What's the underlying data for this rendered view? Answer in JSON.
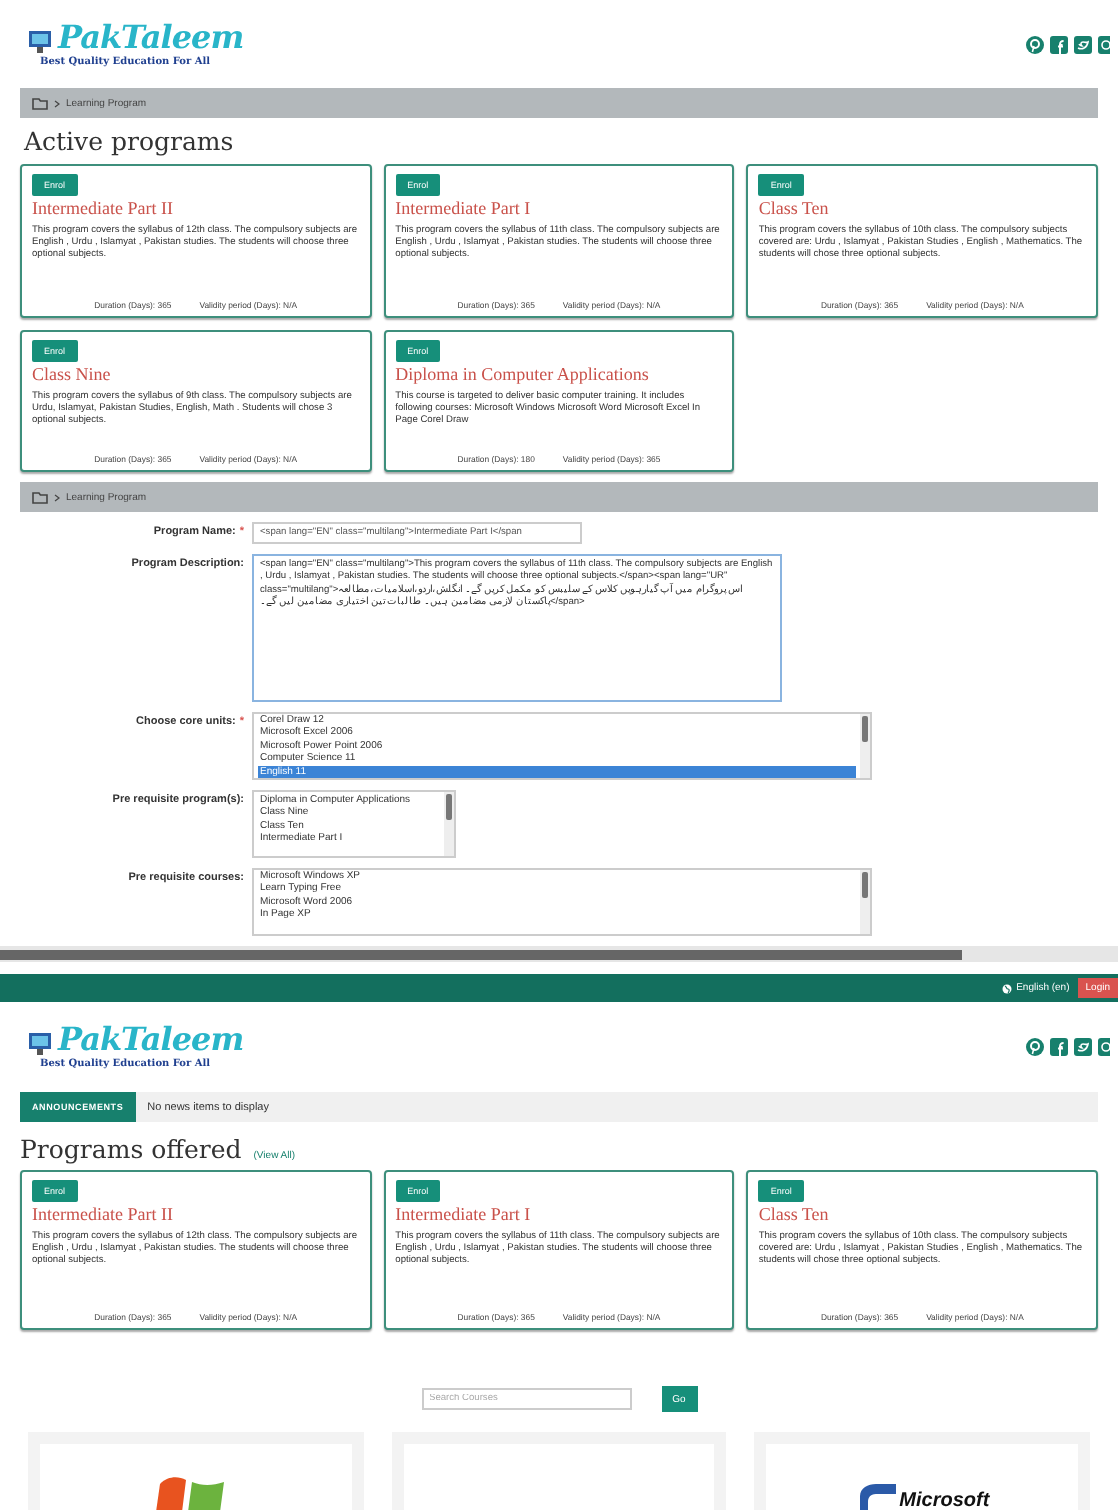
{
  "screen1": {
    "logo": {
      "name": "PakTaleem",
      "tagline": "Best Quality Education For All"
    },
    "breadcrumb": "Learning Program",
    "heading": "Active programs",
    "programs": [
      {
        "enrol": "Enrol",
        "title": "Intermediate Part II",
        "description": "This program covers the syllabus of 12th class. The compulsory subjects are English , Urdu , Islamyat , Pakistan studies. The students will choose three optional subjects.",
        "duration": "Duration (Days): 365",
        "validity": "Validity period (Days): N/A"
      },
      {
        "enrol": "Enrol",
        "title": "Intermediate Part I",
        "description": "This program covers the syllabus of 11th class. The compulsory subjects are English , Urdu , Islamyat , Pakistan studies. The students will choose three optional subjects.",
        "duration": "Duration (Days): 365",
        "validity": "Validity period (Days): N/A"
      },
      {
        "enrol": "Enrol",
        "title": "Class Ten",
        "description": "This program covers the syllabus of 10th class. The compulsory subjects covered are: Urdu , Islamyat , Pakistan Studies , English , Mathematics. The students will chose three optional subjects.",
        "duration": "Duration (Days): 365",
        "validity": "Validity period (Days): N/A"
      },
      {
        "enrol": "Enrol",
        "title": "Class Nine",
        "description": "This program covers the syllabus of 9th class. The compulsory subjects are Urdu, Islamyat, Pakistan Studies, English, Math . Students will chose 3 optional subjects.",
        "duration": "Duration (Days): 365",
        "validity": "Validity period (Days): N/A"
      },
      {
        "enrol": "Enrol",
        "title": "Diploma in Computer Applications",
        "description": "This course is targeted to deliver basic computer training. It includes following courses: Microsoft Windows Microsoft Word Microsoft Excel In Page Corel Draw",
        "duration": "Duration (Days): 180",
        "validity": "Validity period (Days): 365"
      }
    ]
  },
  "screen2": {
    "breadcrumb": "Learning Program",
    "fields": [
      {
        "kind": "input",
        "label": "Program Name:",
        "required_mark": "*",
        "value": "<span lang=\"EN\" class=\"multilang\">Intermediate Part I</span"
      },
      {
        "kind": "textarea",
        "label": "Program Description:",
        "value": "<span lang=\"EN\" class=\"multilang\">This program covers the syllabus of 11th class. The compulsory subjects are English , Urdu , Islamyat , Pakistan studies. The students will choose three optional subjects.</span><span lang=\"UR\" class=\"multilang\">اس پروگرام میں آپ گیارہویں کلاس کے سلیبس کو مکمل کریں گے۔ انگلش،اردو،اسلامیات،مطالعہ پاکستان لازمی مضامین ہیں۔ طالبات تین اختیاری مضامین لیں گے۔</span>"
      },
      {
        "kind": "listbox",
        "label": "Choose core units:",
        "required_mark": "*",
        "options": [
          {
            "text": "Corel Draw 12",
            "selected": false
          },
          {
            "text": "Microsoft Excel 2006",
            "selected": false
          },
          {
            "text": "Microsoft Power Point 2006",
            "selected": false
          },
          {
            "text": "Computer Science 11",
            "selected": false
          },
          {
            "text": "English 11",
            "selected": true
          }
        ]
      },
      {
        "kind": "listbox-narrow",
        "label": "Pre requisite program(s):",
        "options": [
          {
            "text": "Diploma in Computer Applications",
            "selected": false
          },
          {
            "text": "Class Nine",
            "selected": false
          },
          {
            "text": "Class Ten",
            "selected": false
          },
          {
            "text": "Intermediate Part I",
            "selected": false
          }
        ]
      },
      {
        "kind": "listbox",
        "label": "Pre requisite courses:",
        "options": [
          {
            "text": "Microsoft Windows XP",
            "selected": false
          },
          {
            "text": "Learn Typing Free",
            "selected": false
          },
          {
            "text": "Microsoft Word 2006",
            "selected": false
          },
          {
            "text": "In Page XP",
            "selected": false
          }
        ]
      }
    ]
  },
  "screen3": {
    "top_bar": {
      "language": "English (en)",
      "login": "Login"
    },
    "logo": {
      "name": "PakTaleem",
      "tagline": "Best Quality Education For All"
    },
    "announcements": {
      "label": "ANNOUNCEMENTS",
      "text": "No news items to display"
    },
    "heading": "Programs offered",
    "view_all": "(View All)",
    "programs": [
      {
        "enrol": "Enrol",
        "title": "Intermediate Part II",
        "description": "This program covers the syllabus of 12th class. The compulsory subjects are English , Urdu , Islamyat , Pakistan studies. The students will choose three optional subjects.",
        "duration": "Duration (Days): 365",
        "validity": "Validity period (Days): N/A"
      },
      {
        "enrol": "Enrol",
        "title": "Intermediate Part I",
        "description": "This program covers the syllabus of 11th class. The compulsory subjects are English , Urdu , Islamyat , Pakistan studies. The students will choose three optional subjects.",
        "duration": "Duration (Days): 365",
        "validity": "Validity period (Days): N/A"
      },
      {
        "enrol": "Enrol",
        "title": "Class Ten",
        "description": "This program covers the syllabus of 10th class. The compulsory subjects covered are: Urdu , Islamyat , Pakistan Studies , English , Mathematics. The students will chose three optional subjects.",
        "duration": "Duration (Days): 365",
        "validity": "Validity period (Days): N/A"
      }
    ],
    "search": {
      "placeholder": "Search Courses",
      "button": "Go"
    },
    "course_tiles": [
      {
        "kind": "windows-logo"
      },
      {
        "kind": "blank"
      },
      {
        "kind": "office-logo",
        "text": "Microsoft"
      }
    ]
  }
}
